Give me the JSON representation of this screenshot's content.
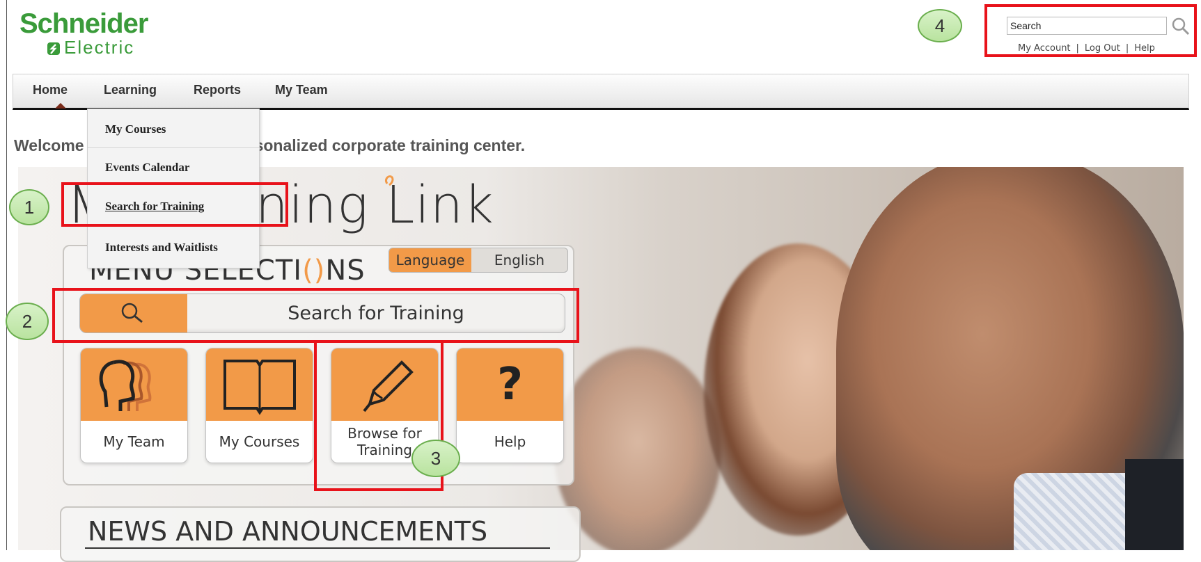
{
  "header": {
    "logo_line1": "Schneider",
    "logo_line2": "Electric",
    "search_placeholder": "Search",
    "account_links": [
      "My Account",
      "Log Out",
      "Help"
    ],
    "separator": "|"
  },
  "nav": {
    "items": [
      "Home",
      "Learning",
      "Reports",
      "My Team"
    ],
    "active": "Home"
  },
  "dropdown": {
    "items": [
      "My Courses",
      "Events Calendar",
      "Search for Training",
      "Interests and Waitlists"
    ]
  },
  "welcome_text": "sonalized corporate training center.",
  "welcome_prefix": "Welcome",
  "hero": {
    "title_visible": "ning Link",
    "title_prefix": "M"
  },
  "menu_panel": {
    "title": "MENU SELECTI",
    "title_suffix": "NS",
    "language_label": "Language",
    "language_value": "English",
    "search_training_label": "Search for Training",
    "tiles": [
      {
        "label": "My Team",
        "icon": "team-heads-icon"
      },
      {
        "label": "My Courses",
        "icon": "book-icon"
      },
      {
        "label": "Browse for Training",
        "icon": "pencil-icon"
      },
      {
        "label": "Help",
        "icon": "question-icon"
      }
    ]
  },
  "news": {
    "title": "NEWS AND ANNOUNCEMENTS"
  },
  "callouts": [
    "1",
    "2",
    "3",
    "4"
  ],
  "colors": {
    "brand_green": "#3a9b3a",
    "accent_orange": "#f29a48",
    "highlight_red": "#e8121a",
    "callout_green": "#b9e39f"
  }
}
